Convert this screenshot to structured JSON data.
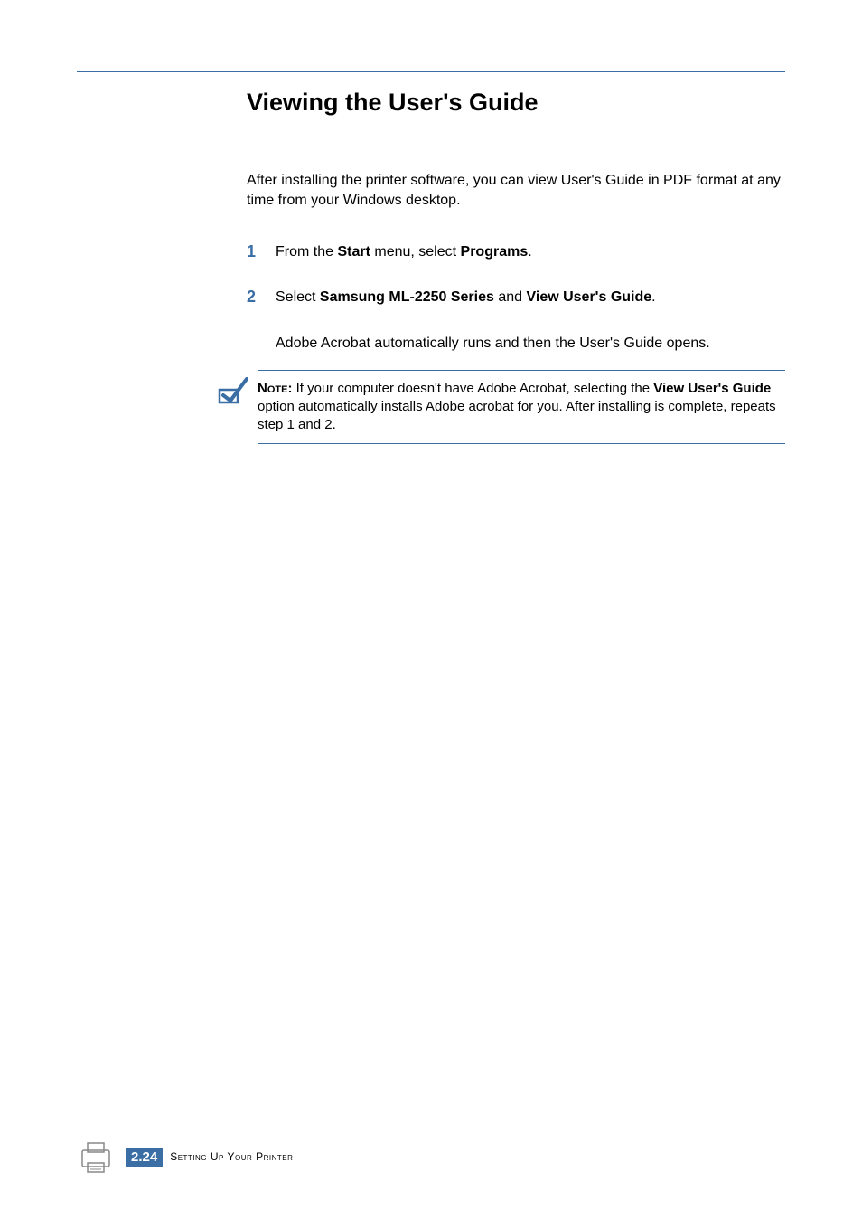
{
  "heading": "Viewing the User's Guide",
  "intro": "After installing the printer software, you can view User's Guide in PDF format at any time from your Windows desktop.",
  "steps": {
    "s1": {
      "num": "1",
      "pre": "From the ",
      "b1": "Start",
      "mid": " menu, select ",
      "b2": "Programs",
      "post": "."
    },
    "s2": {
      "num": "2",
      "pre": "Select ",
      "b1": "Samsung ML-2250 Series",
      "mid": " and ",
      "b2": "View User's Guide",
      "post": ".",
      "followup": "Adobe Acrobat automatically runs and then the User's Guide opens."
    }
  },
  "note": {
    "label": "Note:",
    "pre": " If your computer doesn't have Adobe Acrobat, selecting the ",
    "b1": "View User's Guide",
    "post": " option automatically installs Adobe acrobat for you. After installing is complete, repeats step 1 and 2."
  },
  "footer": {
    "page_prefix": "2.",
    "page_num": "24",
    "title": "Setting Up Your Printer"
  }
}
